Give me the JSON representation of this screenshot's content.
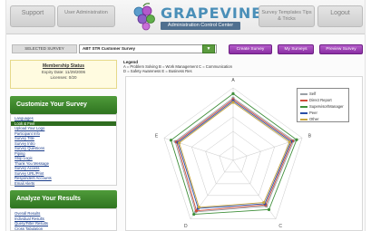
{
  "header": {
    "support_label": "Support",
    "user_admin_label": "User Administration",
    "logo_text": "GRAPEVINE",
    "logo_subtitle": "Administration Control Center",
    "survey_templates_label": "Survey Templates Tips & Tricks",
    "logout_label": "Logout"
  },
  "survey_bar": {
    "selected_label": "SELECTED SURVEY",
    "selected_value": "ABT STR Customer Survey",
    "create_label": "Create Survey",
    "my_surveys_label": "My Surveys",
    "preview_label": "Preview Survey"
  },
  "membership": {
    "title": "Membership Status",
    "expiry": "Expiry Date: 11/29/2006",
    "licenses": "Licenses: 0/20"
  },
  "customize": {
    "heading": "Customize Your Survey",
    "items": [
      {
        "label": "Languages"
      },
      {
        "label": "Look & Feel"
      },
      {
        "label": "Upload Your Logo"
      },
      {
        "label": "Participant Info"
      },
      {
        "label": "Survey Title"
      },
      {
        "label": "Survey Intro"
      },
      {
        "label": "Survey Questions"
      },
      {
        "label": "Piping"
      },
      {
        "label": "Stop Logic"
      },
      {
        "label": "Thank You Message"
      },
      {
        "label": "Survey Access"
      },
      {
        "label": "Survey URL/Print"
      },
      {
        "label": "Respondent Accounts"
      },
      {
        "label": "Email Alerts"
      }
    ],
    "active_index": 1
  },
  "analyze": {
    "heading": "Analyze Your Results",
    "items": [
      {
        "label": "Overall Results"
      },
      {
        "label": "Individual Results"
      },
      {
        "label": "Query/Filter Results"
      },
      {
        "label": "Cross Tabulation"
      }
    ]
  },
  "legend": {
    "heading": "Legend",
    "row1": "A = Problem Solving   B = Work Management   C = Communication",
    "row2": "D = Safety Awareness   E = Business Res"
  },
  "chart_key": [
    {
      "name": "Self",
      "color": "#9aa0a6"
    },
    {
      "name": "Direct Report",
      "color": "#d04a3a"
    },
    {
      "name": "Supervisor/Manager",
      "color": "#3f8f3a"
    },
    {
      "name": "Peer",
      "color": "#2b4fa8"
    },
    {
      "name": "Other",
      "color": "#c8a640"
    }
  ],
  "chart_data": {
    "type": "radar",
    "categories": [
      "A",
      "B",
      "C",
      "D",
      "E"
    ],
    "rmax": 5,
    "series": [
      {
        "name": "Self",
        "color": "#9aa0a6",
        "values": [
          4.3,
          4.4,
          3.9,
          4.4,
          4.2
        ]
      },
      {
        "name": "Direct Report",
        "color": "#d04a3a",
        "values": [
          4.2,
          4.3,
          3.8,
          4.3,
          4.1
        ]
      },
      {
        "name": "Supervisor/Manager",
        "color": "#3f8f3a",
        "values": [
          4.6,
          4.6,
          4.2,
          4.6,
          4.5
        ]
      },
      {
        "name": "Peer",
        "color": "#2b4fa8",
        "values": [
          4.1,
          4.2,
          3.7,
          4.1,
          4.0
        ]
      },
      {
        "name": "Other",
        "color": "#c8a640",
        "values": [
          4.0,
          4.1,
          3.6,
          4.0,
          3.9
        ]
      }
    ]
  }
}
